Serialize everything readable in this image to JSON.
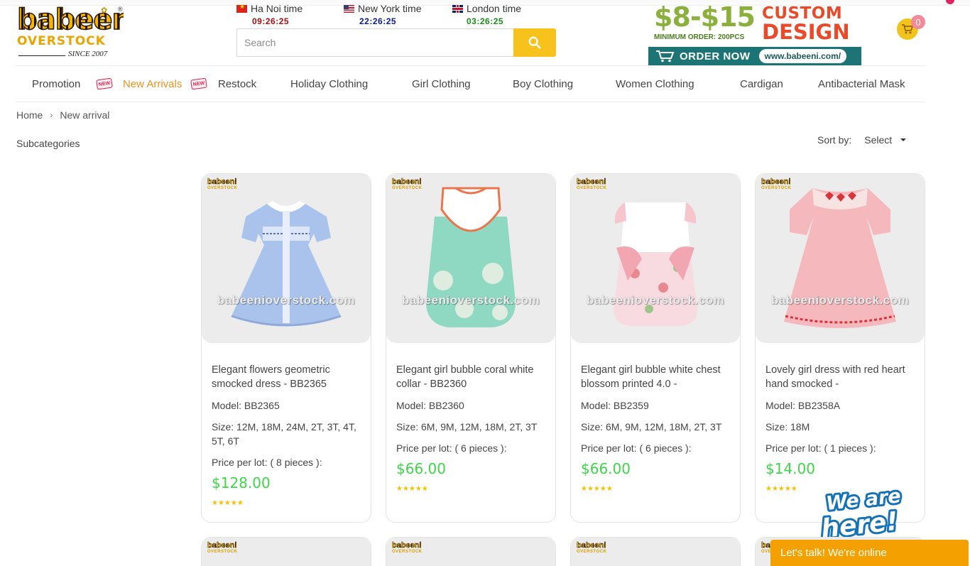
{
  "brand": {
    "logo_top": "babeeni",
    "logo_mid": "OVERSTOCK",
    "logo_since": "SINCE 2007",
    "registered": "®"
  },
  "clocks": [
    {
      "label": "Ha Noi time",
      "time": "09:26:25",
      "color": "#a50e0e"
    },
    {
      "label": "New York time",
      "time": "22:26:25",
      "color": "#0a1a8a"
    },
    {
      "label": "London time",
      "time": "03:26:25",
      "color": "#1a8a1a"
    }
  ],
  "search": {
    "placeholder": "Search"
  },
  "banner": {
    "price": "$8-$15",
    "min_order": "MINIMUM ORDER: 200PCS",
    "custom": "CUSTOM",
    "design": "DESIGN",
    "order_now": "ORDER NOW",
    "url": "www.babeeni.com/"
  },
  "cart": {
    "count": "0"
  },
  "nav": [
    {
      "label": "Promotion"
    },
    {
      "label": "New Arrivals"
    },
    {
      "label": "Restock"
    },
    {
      "label": "Holiday Clothing"
    },
    {
      "label": "Girl Clothing"
    },
    {
      "label": "Boy Clothing"
    },
    {
      "label": "Women Clothing"
    },
    {
      "label": "Cardigan"
    },
    {
      "label": "Antibacterial Mask"
    }
  ],
  "new_badge": "NEW",
  "breadcrumb": {
    "home": "Home",
    "sep": "›",
    "current": "New arrival"
  },
  "subcategories": "Subcategories",
  "sort": {
    "label": "Sort by:",
    "value": "Select"
  },
  "mini_logo": {
    "top": "babeeni",
    "bottom": "OVERSTOCK"
  },
  "watermark": "babeenioverstock.com",
  "products": [
    {
      "title": "Elegant flowers geometric smocked dress - BB2365",
      "model": "Model: BB2365",
      "size": "Size: 12M, 18M, 24M, 2T, 3T, 4T, 5T, 6T",
      "lot": "Price per lot: ( 8 pieces ):",
      "price": "$128.00",
      "stars": "★★★★★"
    },
    {
      "title": "Elegant girl bubble coral white collar - BB2360",
      "model": "Model: BB2360",
      "size": "Size: 6M, 9M, 12M, 18M, 2T, 3T",
      "lot": "Price per lot: ( 6 pieces ):",
      "price": "$66.00",
      "stars": "★★★★★"
    },
    {
      "title": "Elegant girl bubble white chest blossom printed 4.0 -",
      "model": "Model: BB2359",
      "size": "Size: 6M, 9M, 12M, 18M, 2T, 3T",
      "lot": "Price per lot: ( 6 pieces ):",
      "price": "$66.00",
      "stars": "★★★★★"
    },
    {
      "title": "Lovely girl dress with red heart hand smocked -",
      "model": "Model: BB2358A",
      "size": "Size: 18M",
      "lot": "Price per lot: ( 1 pieces ):",
      "price": "$14.00",
      "stars": "★★★★★"
    }
  ],
  "chat": {
    "we_are": "We are",
    "here": "here!",
    "bar": "Let's talk! We're online"
  },
  "colors": {
    "accent": "#f6c21b",
    "price": "#3fd64a",
    "nav_active": "#f0921c",
    "chat": "#f4a100"
  }
}
